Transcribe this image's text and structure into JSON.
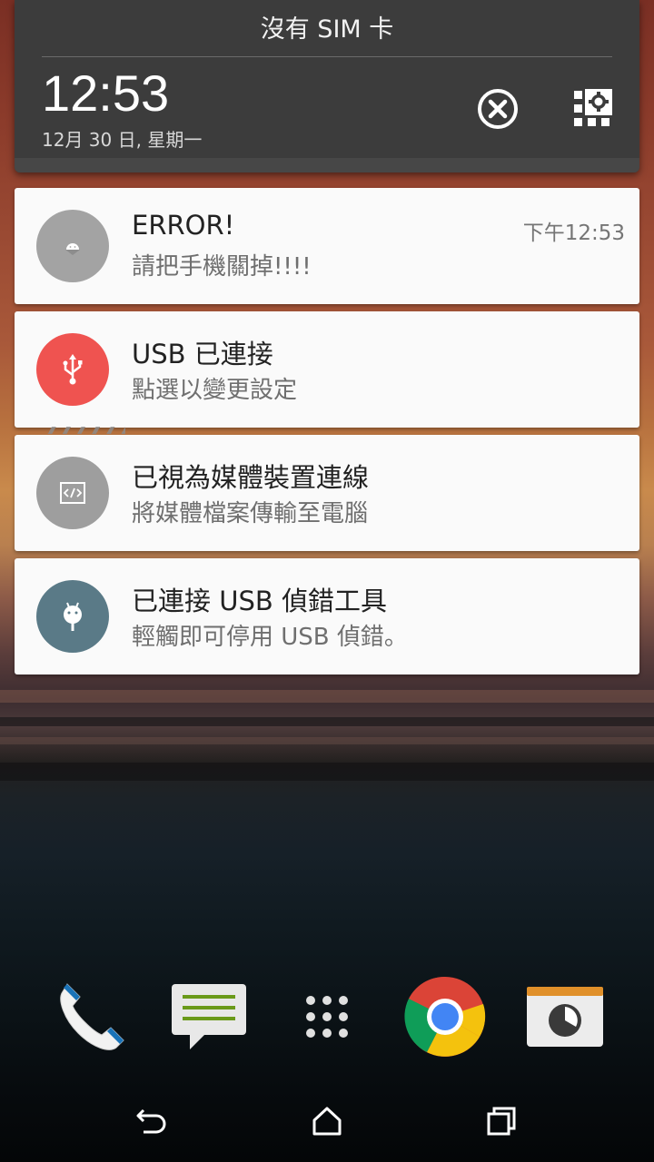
{
  "quick_panel": {
    "sim_status": "沒有 SIM 卡",
    "time": "12:53",
    "date": "12月 30 日, 星期一"
  },
  "notifications": [
    {
      "title": "ERROR!",
      "subtitle": "請把手機關掉!!!!",
      "time": "下午12:53",
      "icon": "android-icon",
      "icon_bg": "#a3a3a3"
    },
    {
      "title": "USB 已連接",
      "subtitle": "點選以變更設定",
      "icon": "usb-icon",
      "icon_bg": "#ef5350"
    },
    {
      "title": "已視為媒體裝置連線",
      "subtitle": "將媒體檔案傳輸至電腦",
      "icon": "code-file-icon",
      "icon_bg": "#9e9e9e"
    },
    {
      "title": "已連接 USB 偵錯工具",
      "subtitle": "輕觸即可停用 USB 偵錯。",
      "icon": "debug-android-icon",
      "icon_bg": "#5a7a87"
    }
  ],
  "dock": [
    "phone-icon",
    "messages-icon",
    "app-drawer-icon",
    "chrome-icon",
    "camera-icon"
  ],
  "nav_bar": [
    "back-icon",
    "home-icon",
    "recents-icon"
  ]
}
